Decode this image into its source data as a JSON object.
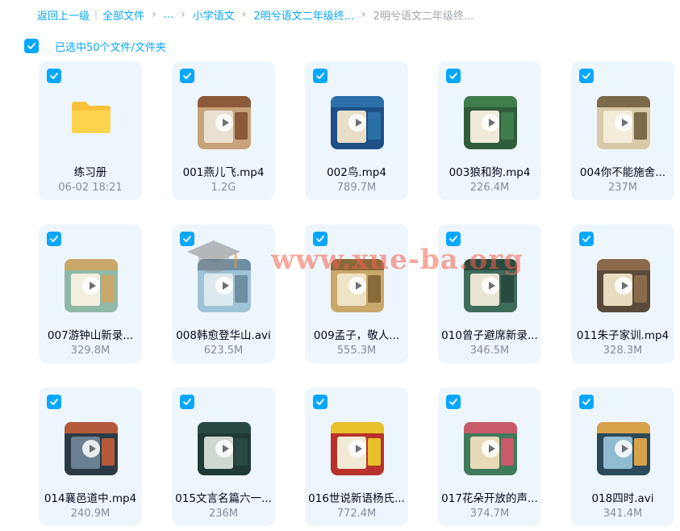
{
  "breadcrumb": {
    "back": "返回上一级",
    "all_files": "全部文件",
    "ellipsis": "...",
    "level1": "小学语文",
    "level2": "2明兮语文二年级终...",
    "current": "2明兮语文二年级终..."
  },
  "selection": {
    "label": "已选中50个文件/文件夹"
  },
  "watermark": "www.xue-ba.org",
  "files": [
    {
      "type": "folder",
      "name": "练习册",
      "meta": "06-02 18:21",
      "colors": [
        "#f8c33a",
        "#f8c33a",
        "#f8c33a"
      ]
    },
    {
      "type": "video",
      "name": "001燕儿飞.mp4",
      "meta": "1.2G",
      "colors": [
        "#c8a27a",
        "#e8e1d2",
        "#8a5a3a"
      ]
    },
    {
      "type": "video",
      "name": "002鸟.mp4",
      "meta": "789.7M",
      "colors": [
        "#1e4f86",
        "#e9dfc8",
        "#2a6fa8"
      ]
    },
    {
      "type": "video",
      "name": "003狼和狗.mp4",
      "meta": "226.4M",
      "colors": [
        "#2f5d3a",
        "#f1ead8",
        "#3f7d4a"
      ]
    },
    {
      "type": "video",
      "name": "004你不能施舍...",
      "meta": "237M",
      "colors": [
        "#d8c9a8",
        "#f3ecd9",
        "#7a6a4a"
      ]
    },
    {
      "type": "video",
      "name": "007游钟山新录...",
      "meta": "329.8M",
      "colors": [
        "#8fb9a6",
        "#f4eee0",
        "#c8a76a"
      ]
    },
    {
      "type": "video",
      "name": "008韩愈登华山.avi",
      "meta": "623.5M",
      "colors": [
        "#9fc3d6",
        "#dce9ef",
        "#6d8fa3"
      ]
    },
    {
      "type": "video",
      "name": "009孟子，敬人...",
      "meta": "555.3M",
      "colors": [
        "#c9a86a",
        "#efe3c6",
        "#8a6a3a"
      ]
    },
    {
      "type": "video",
      "name": "010曾子避席新录...",
      "meta": "346.5M",
      "colors": [
        "#3f6b5a",
        "#e9e4d4",
        "#2a4a3f"
      ]
    },
    {
      "type": "video",
      "name": "011朱子家训.mp4",
      "meta": "328.3M",
      "colors": [
        "#5a4a3a",
        "#e8dcc0",
        "#8a6a4a"
      ]
    },
    {
      "type": "video",
      "name": "014襄邑道中.mp4",
      "meta": "240.9M",
      "colors": [
        "#2a3a44",
        "#6b8090",
        "#b45a3a"
      ]
    },
    {
      "type": "video",
      "name": "015文言名篇六一...",
      "meta": "236M",
      "colors": [
        "#1f3a34",
        "#cfd8d0",
        "#284a42"
      ]
    },
    {
      "type": "video",
      "name": "016世说新语杨氏...",
      "meta": "772.4M",
      "colors": [
        "#b9322a",
        "#f3ead6",
        "#e8c12a"
      ]
    },
    {
      "type": "video",
      "name": "017花朵开放的声...",
      "meta": "374.7M",
      "colors": [
        "#3f7a5a",
        "#e8d9b8",
        "#c85a6a"
      ]
    },
    {
      "type": "video",
      "name": "018四时.avi",
      "meta": "341.4M",
      "colors": [
        "#2a4a5a",
        "#8fbcd0",
        "#d8a24a"
      ]
    }
  ]
}
